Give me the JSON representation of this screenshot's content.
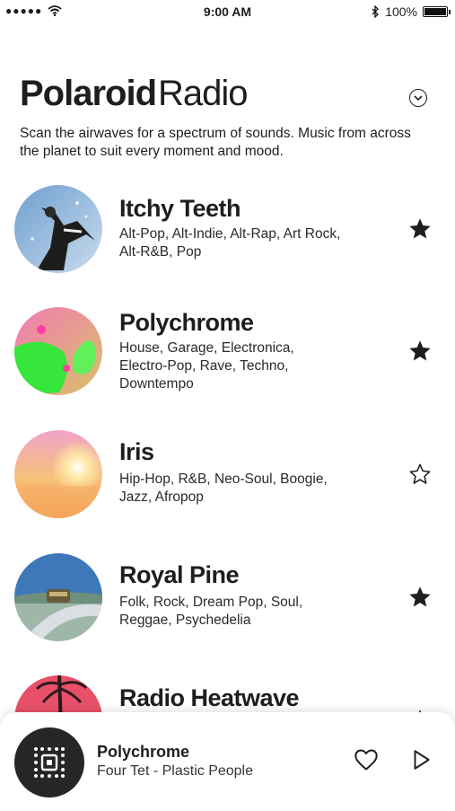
{
  "status": {
    "time": "9:00 AM",
    "battery": "100%",
    "battery_level": 1.0
  },
  "header": {
    "brand_bold": "Polaroid",
    "brand_light": "Radio",
    "description": "Scan the airwaves for a spectrum of sounds. Music from across the planet to suit every moment and mood."
  },
  "stations": [
    {
      "title": "Itchy Teeth",
      "genres": "Alt-Pop, Alt-Indie, Alt-Rap, Art Rock, Alt-R&B, Pop",
      "favorited": true
    },
    {
      "title": "Polychrome",
      "genres": "House, Garage, Electronica, Electro-Pop, Rave, Techno, Downtempo",
      "favorited": true
    },
    {
      "title": "Iris",
      "genres": "Hip-Hop, R&B, Neo-Soul, Boogie, Jazz, Afropop",
      "favorited": false
    },
    {
      "title": "Royal Pine",
      "genres": "Folk, Rock, Dream Pop, Soul, Reggae, Psychedelia",
      "favorited": true
    },
    {
      "title": "Radio Heatwave",
      "genres": "",
      "favorited": true
    }
  ],
  "now_playing": {
    "station": "Polychrome",
    "track": "Four Tet - Plastic People"
  },
  "colors": {
    "text": "#1e1e1e",
    "background": "#ffffff",
    "np_art": "#262626"
  },
  "icons": {
    "signal": "signal-dots-icon",
    "wifi": "wifi-icon",
    "bluetooth": "bluetooth-icon",
    "battery": "battery-icon",
    "chevron": "chevron-down-icon",
    "star_filled": "star-filled-icon",
    "star_outline": "star-outline-icon",
    "heart": "heart-outline-icon",
    "play": "play-icon"
  }
}
